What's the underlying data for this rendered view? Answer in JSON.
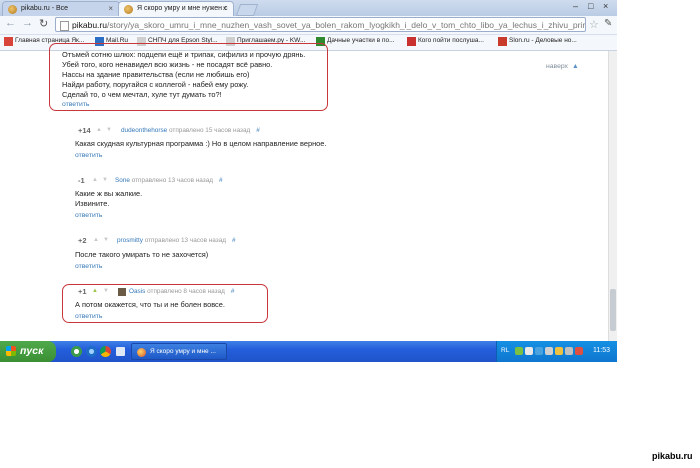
{
  "browser": {
    "tabs": [
      {
        "label": "pikabu.ru - Все",
        "active": false
      },
      {
        "label": "Я скоро умру и мне нужен с",
        "active": true
      }
    ],
    "url_host": "pikabu.ru",
    "url_path": "/story/ya_skoro_umru_i_mne_nuzhen_vash_sovet_ya_bolen_rakom_lyogkikh_i_delo_v_tom_chto_libo_ya_lechus_i_zhivu_prir",
    "bookmarks": [
      {
        "label": "Главная страница Як...",
        "icon": "yandex-icon",
        "color": "#d9443a"
      },
      {
        "label": "Mail.Ru",
        "icon": "mailru-icon",
        "color": "#2b6fc4"
      },
      {
        "label": "СНПЧ для Epson Styl...",
        "icon": "page-icon",
        "color": "#cfcfcf"
      },
      {
        "label": "Приглашаем.ру - KW...",
        "icon": "page-icon",
        "color": "#cfcfcf"
      },
      {
        "label": "Дачные участки в по...",
        "icon": "green-square-icon",
        "color": "#2f8a2f"
      },
      {
        "label": "Кого пойти послуша...",
        "icon": "red-circle-icon",
        "color": "#c93030"
      },
      {
        "label": "Slon.ru - Деловые но...",
        "icon": "slon-icon",
        "color": "#c83a2a"
      }
    ]
  },
  "page": {
    "scroll_top_label": "наверх",
    "quoted_comment_lines": [
      "Отъмей сотню шлюх: подцепи ещё и трипак, сифилиз и прочую дрянь.",
      "Убей того, кого ненавидел всю жизнь - не посадят всё равно.",
      "Нассы на здание правительства (если не любишь его)",
      "Найди работу, поругайся с коллегой - набей ему рожу.",
      "Сделай то, о чем мечтал, хуле тут думать то?!"
    ],
    "reply_label": "ответить",
    "comments": [
      {
        "score": "+14",
        "user": "dudeonthehorse",
        "time": "отправлено 15 часов назад",
        "hash": "#",
        "lines": [
          "Какая скудная культурная программа :) Но в целом направление верное."
        ]
      },
      {
        "score": "-1",
        "user": "Sone",
        "time": "отправлено 13 часов назад",
        "hash": "#",
        "lines": [
          "Какие ж вы жалкие.",
          "Извините."
        ]
      },
      {
        "score": "+2",
        "user": "prosmitty",
        "time": "отправлено 13 часов назад",
        "hash": "#",
        "lines": [
          "После такого умирать то не захочется)"
        ]
      },
      {
        "score": "+1",
        "user": "Oasis",
        "time": "отправлено 8 часов назад",
        "hash": "#",
        "lines": [
          "А потом окажется, что ты и не болен вовсе."
        ]
      }
    ]
  },
  "taskbar": {
    "start_label": "пуск",
    "task_button": "Я скоро умру и мне ...",
    "language": "RL",
    "clock": "11:53"
  },
  "watermark": "pikabu.ru"
}
